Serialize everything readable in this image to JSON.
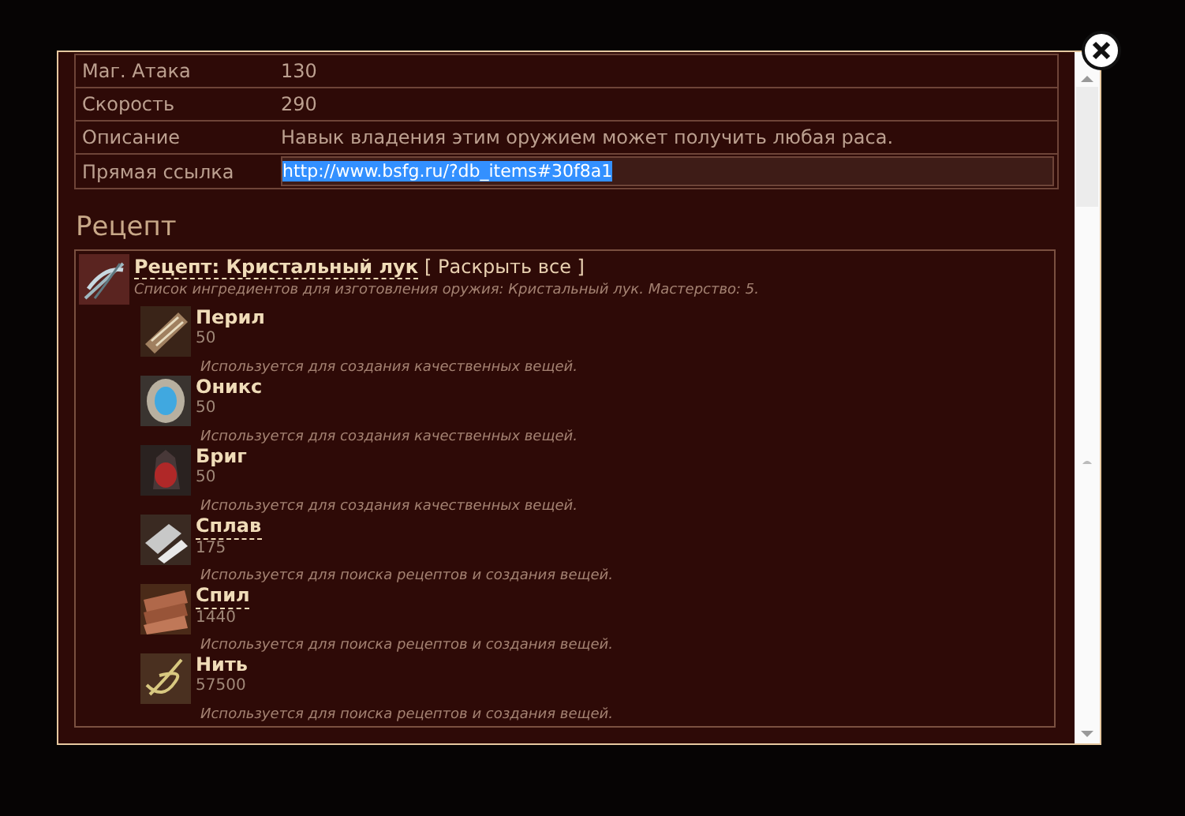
{
  "properties": [
    {
      "label": "Маг. Атака",
      "value": "130",
      "kind": "text"
    },
    {
      "label": "Скорость",
      "value": "290",
      "kind": "text"
    },
    {
      "label": "Описание",
      "value": "Навык владения этим оружием может получить любая раса.",
      "kind": "text"
    },
    {
      "label": "Прямая ссылка",
      "value": "http://www.bsfg.ru/?db_items#30f8a1",
      "kind": "link-field"
    }
  ],
  "recipe": {
    "heading": "Рецепт",
    "title": "Рецепт: Кристальный лук",
    "expand_all": "[ Раскрыть все ]",
    "description": "Список ингредиентов для изготовления оружия: Кристальный лук. Мастерство: 5.",
    "ingredients": [
      {
        "name": "Перил",
        "quantity": "50",
        "description": "Используется для создания качественных вещей.",
        "has_recipe": false
      },
      {
        "name": "Оникс",
        "quantity": "50",
        "description": "Используется для создания качественных вещей.",
        "has_recipe": false
      },
      {
        "name": "Бриг",
        "quantity": "50",
        "description": "Используется для создания качественных вещей.",
        "has_recipe": false
      },
      {
        "name": "Сплав",
        "quantity": "175",
        "description": "Используется для поиска рецептов и создания вещей.",
        "has_recipe": true
      },
      {
        "name": "Спил",
        "quantity": "1440",
        "description": "Используется для поиска рецептов и создания вещей.",
        "has_recipe": true
      },
      {
        "name": "Нить",
        "quantity": "57500",
        "description": "Используется для поиска рецептов и создания вещей.",
        "has_recipe": false
      }
    ]
  }
}
